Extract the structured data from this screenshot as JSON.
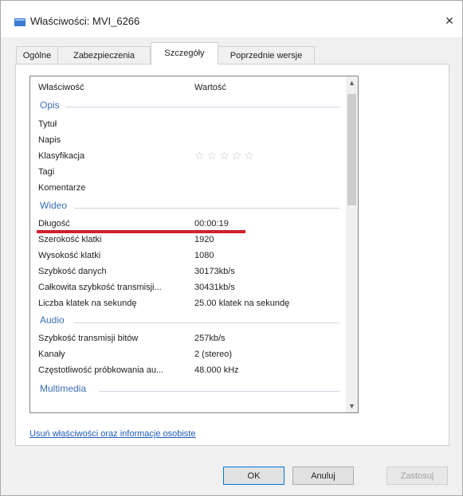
{
  "window": {
    "title": "Właściwości: MVI_6266",
    "close_glyph": "×"
  },
  "tabs": [
    {
      "label": "Ogólne"
    },
    {
      "label": "Zabezpieczenia"
    },
    {
      "label": "Szczegóły",
      "active": true
    },
    {
      "label": "Poprzednie wersje"
    }
  ],
  "details": {
    "header": {
      "property": "Właściwość",
      "value": "Wartość"
    },
    "groups": {
      "opis": "Opis",
      "wideo": "Wideo",
      "audio": "Audio",
      "multimedia": "Multimedia"
    },
    "opis_rows": [
      {
        "name": "Tytuł",
        "value": ""
      },
      {
        "name": "Napis",
        "value": ""
      },
      {
        "name": "Klasyfikacja",
        "value": "☆☆☆☆☆"
      },
      {
        "name": "Tagi",
        "value": ""
      },
      {
        "name": "Komentarze",
        "value": ""
      }
    ],
    "wideo_rows": [
      {
        "name": "Długość",
        "value": "00:00:19"
      },
      {
        "name": "Szerokość klatki",
        "value": "1920"
      },
      {
        "name": "Wysokość klatki",
        "value": "1080"
      },
      {
        "name": "Szybkość danych",
        "value": "30173kb/s"
      },
      {
        "name": "Całkowita szybkość transmisji...",
        "value": "30431kb/s"
      },
      {
        "name": "Liczba klatek na sekundę",
        "value": "25.00 klatek na sekundę"
      }
    ],
    "audio_rows": [
      {
        "name": "Szybkość transmisji bitów",
        "value": "257kb/s"
      },
      {
        "name": "Kanały",
        "value": "2 (stereo)"
      },
      {
        "name": "Częstotliwość próbkowania au...",
        "value": "48.000 kHz"
      }
    ],
    "scroll_up": "▲",
    "scroll_down": "▼"
  },
  "remove_link": "Usuń właściwości oraz informacje osobiste",
  "buttons": {
    "ok": "OK",
    "cancel": "Anuluj",
    "apply": "Zastosuj"
  },
  "colors": {
    "group_heading": "#3a6fb5",
    "highlight_underline": "#d0202c",
    "link": "#1f5cb8"
  }
}
